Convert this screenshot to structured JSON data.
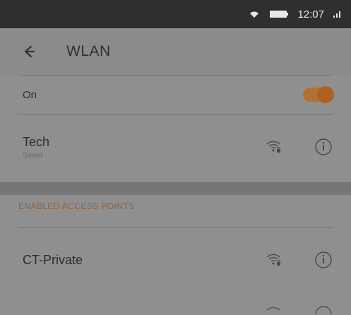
{
  "status_bar": {
    "time": "12:07",
    "icons": [
      "wifi-icon",
      "battery-icon",
      "signal-icon"
    ]
  },
  "header": {
    "back_icon": "back-arrow-icon",
    "title": "WLAN"
  },
  "toggle": {
    "label": "On",
    "enabled": true,
    "accent_color": "#b25d17"
  },
  "connected_network": {
    "name": "Tech",
    "status": "Saved",
    "icons": [
      "wifi-locked-icon",
      "info-icon"
    ]
  },
  "section": {
    "header": "ENABLED ACCESS POINTS"
  },
  "networks": [
    {
      "name": "CT-Private",
      "icons": [
        "wifi-locked-icon",
        "info-icon"
      ]
    }
  ],
  "colors": {
    "overlay": "#8f8f8f",
    "status_bar": "#2f2f2f",
    "accent": "#b25d17"
  }
}
